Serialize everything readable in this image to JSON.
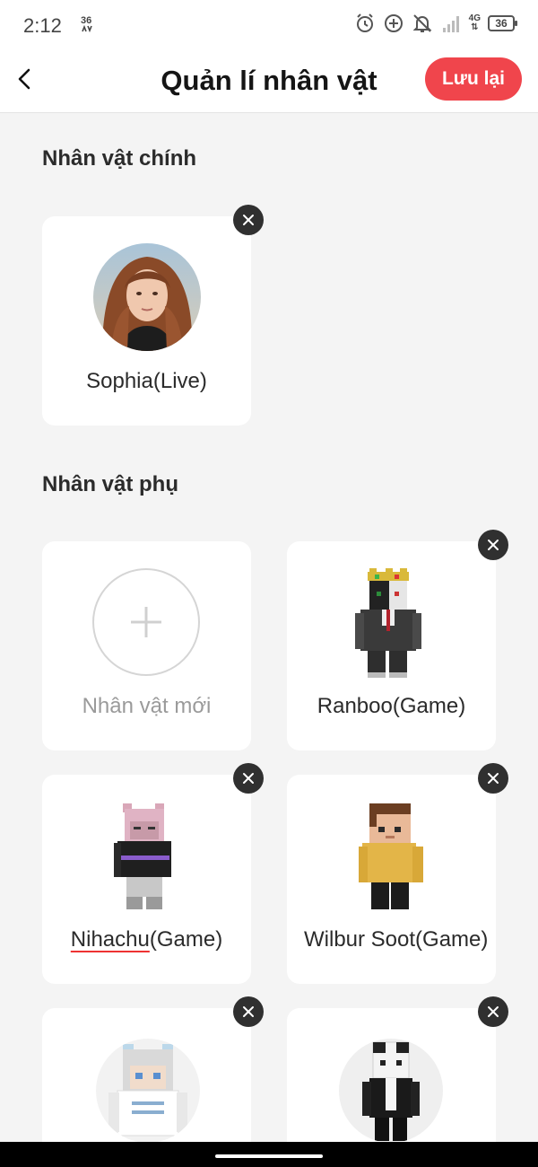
{
  "status_bar": {
    "time": "2:12",
    "data_indicator": "36",
    "network": "4G",
    "battery": "36",
    "icons": [
      "alarm-icon",
      "data-saver-icon",
      "mute-icon",
      "signal-icon"
    ]
  },
  "app_bar": {
    "title": "Quản lí nhân vật",
    "save_label": "Lưu lại",
    "accent_color": "#f0454c"
  },
  "main_section": {
    "title": "Nhân vật chính",
    "character": {
      "name": "Sophia(Live)",
      "avatar": "portrait-photo"
    }
  },
  "secondary_section": {
    "title": "Nhân vật phụ",
    "add_label": "Nhân vật mới",
    "characters": [
      {
        "name": "Ranboo(Game)",
        "avatar": "minecraft-skin-ranboo"
      },
      {
        "name_main": "Nihachu",
        "name_suffix": "(Game)",
        "avatar": "minecraft-skin-nihachu"
      },
      {
        "name": "Wilbur Soot(Game)",
        "avatar": "minecraft-skin-wilbur"
      },
      {
        "name": "",
        "avatar": "minecraft-skin-white-hair"
      },
      {
        "name": "",
        "avatar": "minecraft-skin-black-white"
      }
    ]
  }
}
